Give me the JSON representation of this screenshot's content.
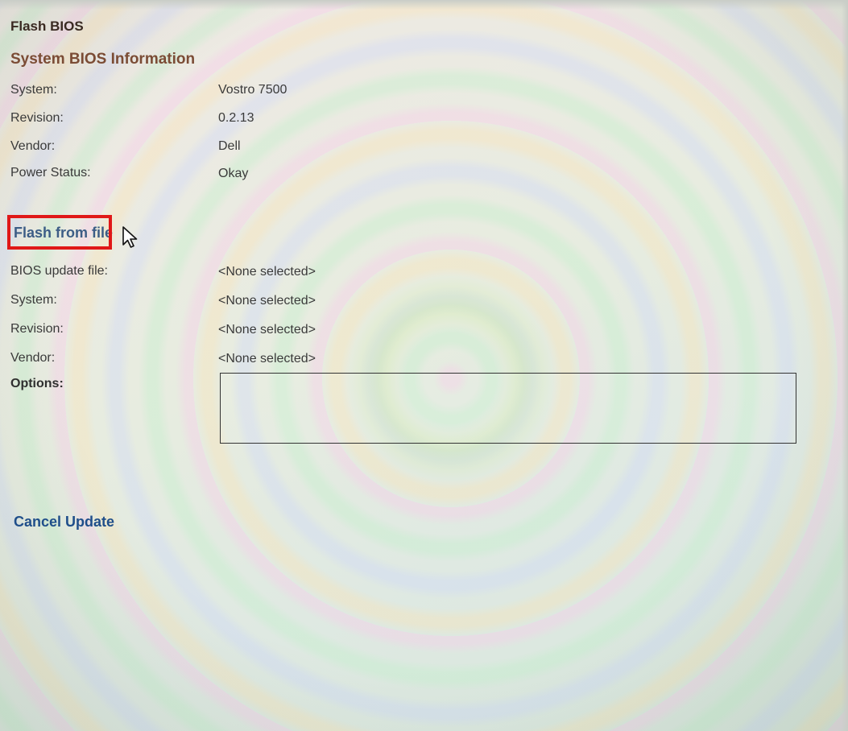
{
  "page": {
    "title": "Flash BIOS"
  },
  "system_info": {
    "heading": "System BIOS Information",
    "rows": [
      {
        "label": "System:",
        "value": "Vostro 7500"
      },
      {
        "label": "Revision:",
        "value": "0.2.13"
      },
      {
        "label": "Vendor:",
        "value": "Dell"
      },
      {
        "label": "Power Status:",
        "value": "Okay"
      }
    ]
  },
  "flash_from_file": {
    "heading": "Flash from file",
    "rows": [
      {
        "label": "BIOS update file:",
        "value": "<None selected>"
      },
      {
        "label": "System:",
        "value": "<None selected>"
      },
      {
        "label": "Revision:",
        "value": "<None selected>"
      },
      {
        "label": "Vendor:",
        "value": "<None selected>"
      }
    ],
    "options_label": "Options:",
    "options_value": ""
  },
  "actions": {
    "cancel_label": "Cancel Update"
  },
  "icons": {
    "cursor": "mouse-pointer-icon"
  },
  "colors": {
    "highlight": "#e01818",
    "link": "#1f4e8a",
    "section_heading": "#7b4c35",
    "flash_heading": "#3c5d86"
  }
}
